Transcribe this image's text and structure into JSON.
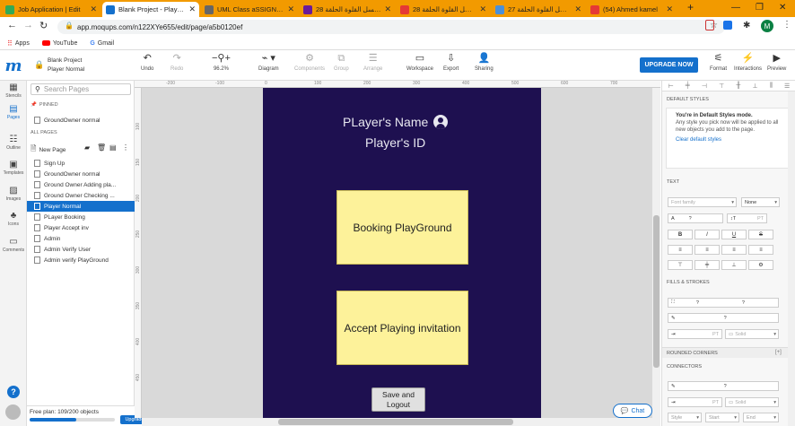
{
  "browser": {
    "tabs": [
      {
        "title": "Job Application | Edit",
        "fav_color": "#3a5"
      },
      {
        "title": "Blank Project - Player N",
        "fav_color": "#1470cc",
        "active": true
      },
      {
        "title": "UML Class aSSIGNMEN",
        "fav_color": "#666"
      },
      {
        "title": "مسلسل القلوة الحلقة 28",
        "fav_color": "#6a1b9a"
      },
      {
        "title": "مسلسل القلوة الحلقة 28",
        "fav_color": "#e53935"
      },
      {
        "title": "مسلسل القلوة الحلقة 27",
        "fav_color": "#4a90d9"
      },
      {
        "title": "(54) Ahmed kamel",
        "fav_color": "#e53935"
      }
    ],
    "new_tab": "+",
    "url": "app.moqups.com/n122XYe655/edit/page/a5b0120ef",
    "bookmarks": [
      "Apps",
      "YouTube",
      "Gmail"
    ],
    "profile_initial": "M"
  },
  "toolbar": {
    "project_title": "Blank Project",
    "page_title": "Player Normal",
    "undo": "Undo",
    "redo": "Redo",
    "zoom": "96.2%",
    "diagram": "Diagram",
    "components": "Components",
    "group": "Group",
    "arrange": "Arrange",
    "workspace": "Workspace",
    "export": "Export",
    "sharing": "Sharing",
    "upgrade": "UPGRADE NOW",
    "format": "Format",
    "interactions": "Interactions",
    "preview": "Preview"
  },
  "iconbar": [
    "Stencils",
    "Pages",
    "Outline",
    "Templates",
    "Images",
    "Icons",
    "Comments"
  ],
  "pages_panel": {
    "search_placeholder": "Search Pages",
    "pinned_label": "PINNED",
    "pinned": [
      "GroundOwner normal"
    ],
    "all_label": "ALL PAGES",
    "new_page": "New Page",
    "pages": [
      "Sign Up",
      "GroundOwner normal",
      "Ground Owner Adding pla...",
      "Ground Owner Checking ...",
      "Player Normal",
      "PLayer Booking",
      "Player Accept inv",
      "Admin",
      "Admin Verify User",
      "Admin verify PlayGround"
    ],
    "selected_index": 4
  },
  "ruler": {
    "h": [
      "-200",
      "-100",
      "0",
      "100",
      "200",
      "300",
      "400",
      "500",
      "600",
      "700"
    ],
    "v": [
      "100",
      "150",
      "200",
      "250",
      "300",
      "350",
      "400",
      "450",
      "500",
      "550",
      "600"
    ]
  },
  "artboard": {
    "player_name": "PLayer's Name",
    "player_id": "Player's ID",
    "booking": "Booking PlayGround",
    "accept": "Accept Playing invitation",
    "save_logout": "Save and\nLogout"
  },
  "free_plan": {
    "text": "Free plan: 109/200 objects",
    "upgrade": "Upgrade",
    "used": 109,
    "total": 200
  },
  "chat": "Chat",
  "right_panel": {
    "default_styles": "DEFAULT STYLES",
    "default_title": "You're in Default Styles mode.",
    "default_desc": "Any style you pick now will be applied to all new objects you add to the page.",
    "clear": "Clear default styles",
    "text": "TEXT",
    "font_family": "Font family",
    "none": "None",
    "fills": "FILLS & STROKES",
    "solid": "Solid",
    "rounded": "ROUNDED CORNERS",
    "connectors": "CONNECTORS",
    "pt": "PT",
    "q": "?",
    "style": "Style",
    "start": "Start",
    "end": "End"
  }
}
